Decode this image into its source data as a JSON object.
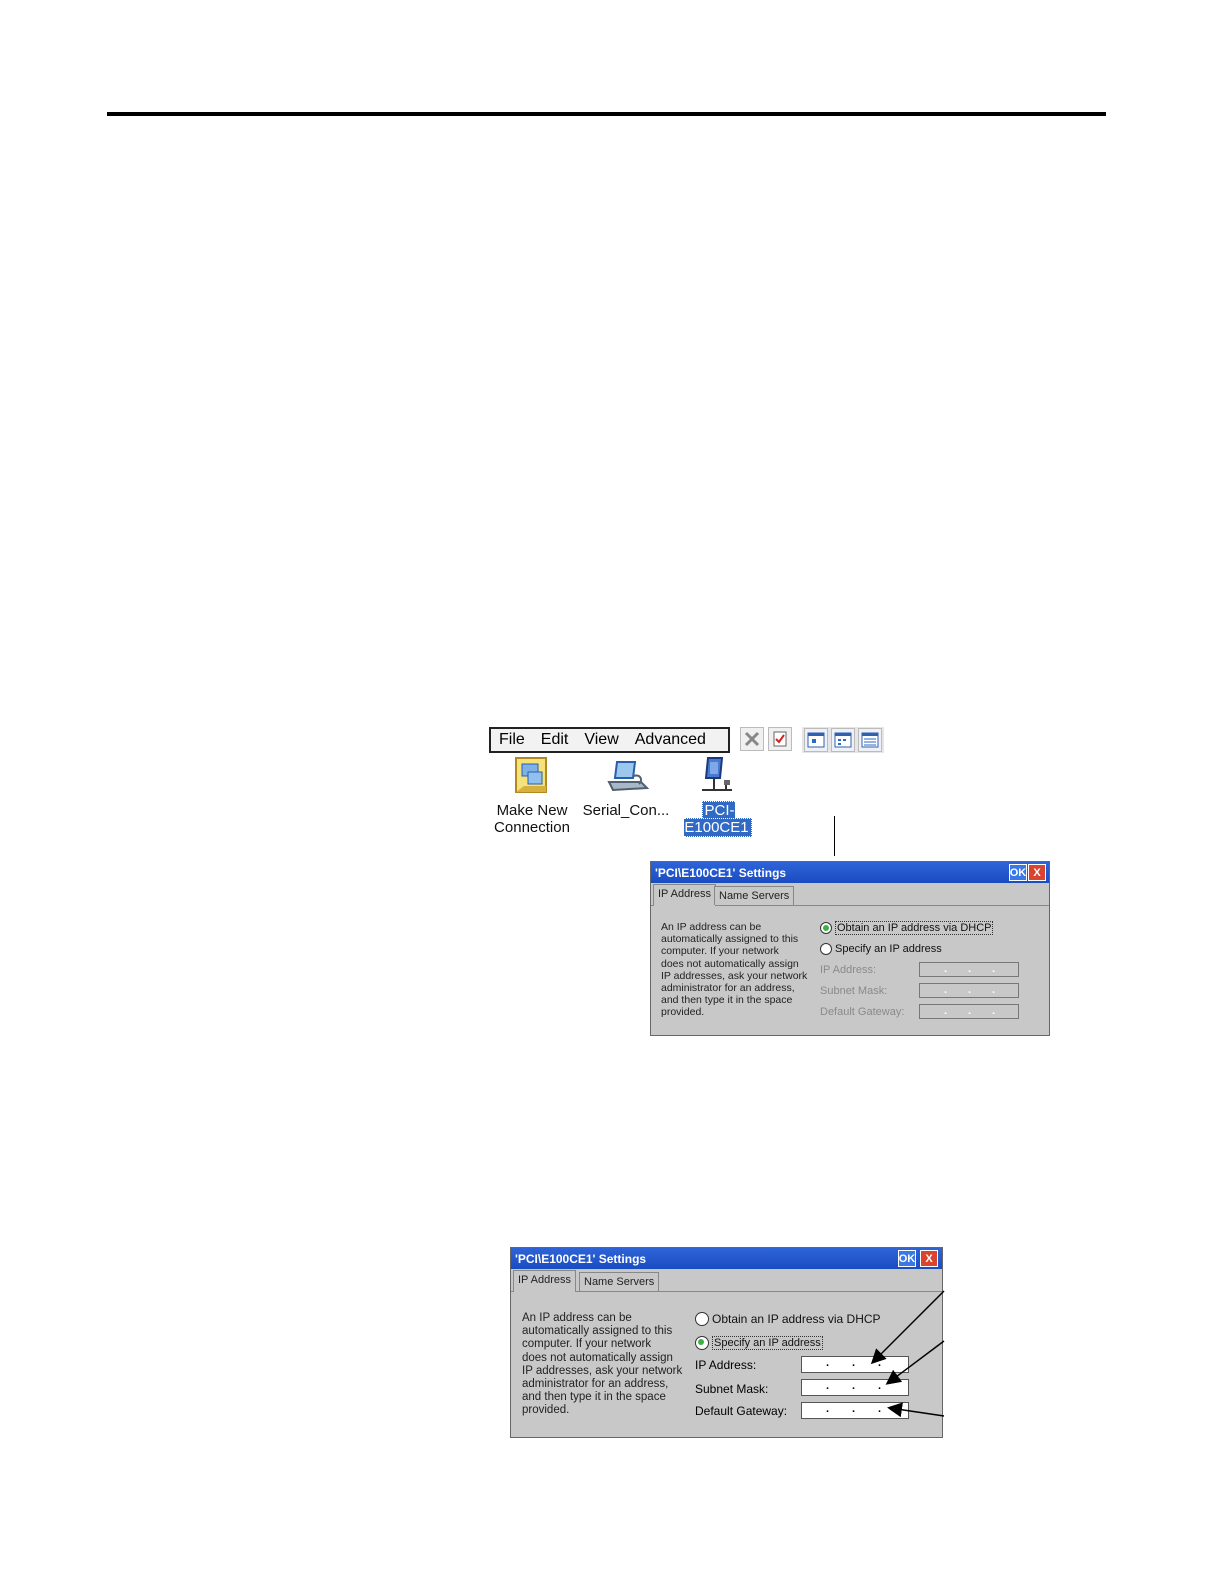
{
  "menu": {
    "file": "File",
    "edit": "Edit",
    "view": "View",
    "advanced": "Advanced"
  },
  "icons": [
    {
      "line1": "Make New",
      "line2": "Connection"
    },
    {
      "line1": "Serial_Con..."
    },
    {
      "line1": "PCI-E100CE1"
    }
  ],
  "dialog1": {
    "title": "'PCI\\E100CE1' Settings",
    "ok": "OK",
    "close": "X",
    "tabs": [
      "IP Address",
      "Name Servers"
    ],
    "description": [
      "An IP address can be",
      "automatically assigned to this",
      "computer.  If your network",
      "does not automatically assign",
      "IP addresses, ask your network",
      "administrator for an address,",
      "and then type it in the space",
      "provided."
    ],
    "option_dhcp": "Obtain an IP address via DHCP",
    "option_specify": "Specify an IP address",
    "ip_label": "IP Address:",
    "subnet_label": "Subnet Mask:",
    "gateway_label": "Default Gateway:"
  },
  "dialog2": {
    "title": "'PCI\\E100CE1' Settings",
    "ok": "OK",
    "close": "X",
    "tabs": [
      "IP Address",
      "Name Servers"
    ],
    "description": [
      "An IP address can be",
      "automatically assigned to this",
      "computer.  If your network",
      "does not automatically assign",
      "IP addresses, ask your network",
      "administrator for an address,",
      "and then type it in the space",
      "provided."
    ],
    "option_dhcp": "Obtain an IP address via DHCP",
    "option_specify": "Specify an IP address",
    "ip_label": "IP Address:",
    "subnet_label": "Subnet Mask:",
    "gateway_label": "Default Gateway:"
  }
}
